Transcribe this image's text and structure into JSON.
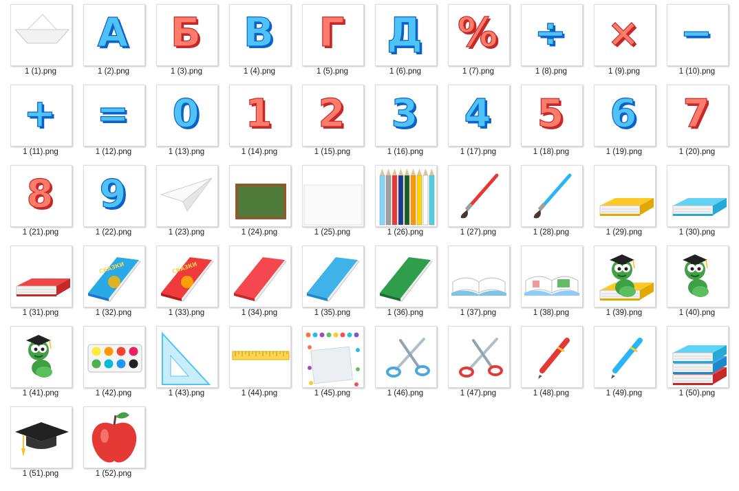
{
  "files": [
    {
      "name": "1 (1).png",
      "icon": "paper-boat-icon"
    },
    {
      "name": "1 (2).png",
      "icon": "letter-a-icon",
      "glyph": "А",
      "colors": [
        "#4fc3f7",
        "#0b63c9"
      ]
    },
    {
      "name": "1 (3).png",
      "icon": "letter-be-icon",
      "glyph": "Б",
      "colors": [
        "#ff7b6b",
        "#c62828"
      ]
    },
    {
      "name": "1 (4).png",
      "icon": "letter-ve-icon",
      "glyph": "В",
      "colors": [
        "#4fc3f7",
        "#0b63c9"
      ]
    },
    {
      "name": "1 (5).png",
      "icon": "letter-ge-icon",
      "glyph": "Г",
      "colors": [
        "#ff7b6b",
        "#c62828"
      ]
    },
    {
      "name": "1 (6).png",
      "icon": "letter-de-icon",
      "glyph": "Д",
      "colors": [
        "#4fc3f7",
        "#0b63c9"
      ]
    },
    {
      "name": "1 (7).png",
      "icon": "percent-sign-icon",
      "glyph": "%",
      "colors": [
        "#ff7b6b",
        "#c62828"
      ]
    },
    {
      "name": "1 (8).png",
      "icon": "division-sign-icon",
      "glyph": "÷",
      "colors": [
        "#4fc3f7",
        "#0b63c9"
      ]
    },
    {
      "name": "1 (9).png",
      "icon": "multiplication-sign-icon",
      "glyph": "×",
      "colors": [
        "#ff7b6b",
        "#c62828"
      ]
    },
    {
      "name": "1 (10).png",
      "icon": "minus-sign-icon",
      "glyph": "−",
      "colors": [
        "#4fc3f7",
        "#0b63c9"
      ]
    },
    {
      "name": "1 (11).png",
      "icon": "plus-sign-icon",
      "glyph": "+",
      "colors": [
        "#4fc3f7",
        "#0b63c9"
      ]
    },
    {
      "name": "1 (12).png",
      "icon": "equals-sign-icon",
      "glyph": "=",
      "colors": [
        "#4fc3f7",
        "#0b63c9"
      ]
    },
    {
      "name": "1 (13).png",
      "icon": "digit-0-icon",
      "glyph": "0",
      "colors": [
        "#4fc3f7",
        "#0b63c9"
      ]
    },
    {
      "name": "1 (14).png",
      "icon": "digit-1-icon",
      "glyph": "1",
      "colors": [
        "#ff7b6b",
        "#c62828"
      ]
    },
    {
      "name": "1 (15).png",
      "icon": "digit-2-icon",
      "glyph": "2",
      "colors": [
        "#ff7b6b",
        "#c62828"
      ]
    },
    {
      "name": "1 (16).png",
      "icon": "digit-3-icon",
      "glyph": "3",
      "colors": [
        "#4fc3f7",
        "#0b63c9"
      ]
    },
    {
      "name": "1 (17).png",
      "icon": "digit-4-icon",
      "glyph": "4",
      "colors": [
        "#4fc3f7",
        "#0b63c9"
      ]
    },
    {
      "name": "1 (18).png",
      "icon": "digit-5-icon",
      "glyph": "5",
      "colors": [
        "#ff7b6b",
        "#c62828"
      ]
    },
    {
      "name": "1 (19).png",
      "icon": "digit-6-icon",
      "glyph": "6",
      "colors": [
        "#4fc3f7",
        "#0b63c9"
      ]
    },
    {
      "name": "1 (20).png",
      "icon": "digit-7-icon",
      "glyph": "7",
      "colors": [
        "#ff7b6b",
        "#c62828"
      ]
    },
    {
      "name": "1 (21).png",
      "icon": "digit-8-icon",
      "glyph": "8",
      "colors": [
        "#ff7b6b",
        "#c62828"
      ]
    },
    {
      "name": "1 (22).png",
      "icon": "digit-9-icon",
      "glyph": "9",
      "colors": [
        "#4fc3f7",
        "#0b63c9"
      ]
    },
    {
      "name": "1 (23).png",
      "icon": "paper-plane-icon"
    },
    {
      "name": "1 (24).png",
      "icon": "chalkboard-icon"
    },
    {
      "name": "1 (25).png",
      "icon": "blank-sheet-icon"
    },
    {
      "name": "1 (26).png",
      "icon": "colored-pencils-icon"
    },
    {
      "name": "1 (27).png",
      "icon": "paintbrush-red-icon",
      "colors": [
        "#e53935"
      ]
    },
    {
      "name": "1 (28).png",
      "icon": "paintbrush-blue-icon",
      "colors": [
        "#29b6f6"
      ]
    },
    {
      "name": "1 (29).png",
      "icon": "book-yellow-icon",
      "colors": [
        "#ffc928",
        "#e0a800"
      ]
    },
    {
      "name": "1 (30).png",
      "icon": "book-cyan-icon",
      "colors": [
        "#5fd3f3",
        "#27a9d6"
      ]
    },
    {
      "name": "1 (31).png",
      "icon": "book-red-icon",
      "colors": [
        "#f04545",
        "#c62828"
      ]
    },
    {
      "name": "1 (32).png",
      "icon": "fairy-tales-book-blue-icon",
      "colors": [
        "#29a9e6",
        "#1976d2"
      ]
    },
    {
      "name": "1 (33).png",
      "icon": "fairy-tales-book-red-icon",
      "colors": [
        "#ef3b3b",
        "#b71c1c"
      ]
    },
    {
      "name": "1 (34).png",
      "icon": "book-standing-red-icon",
      "colors": [
        "#f5474f",
        "#c62828"
      ]
    },
    {
      "name": "1 (35).png",
      "icon": "book-standing-blue-icon",
      "colors": [
        "#3fb2ea",
        "#1e88c9"
      ]
    },
    {
      "name": "1 (36).png",
      "icon": "book-standing-green-icon",
      "colors": [
        "#2e9e4a",
        "#1b6e31"
      ]
    },
    {
      "name": "1 (37).png",
      "icon": "open-book-icon"
    },
    {
      "name": "1 (38).png",
      "icon": "open-book-illustrated-icon"
    },
    {
      "name": "1 (39).png",
      "icon": "bookworm-on-books-icon"
    },
    {
      "name": "1 (40).png",
      "icon": "bookworm-graduate-icon"
    },
    {
      "name": "1 (41).png",
      "icon": "bookworm-standing-icon"
    },
    {
      "name": "1 (42).png",
      "icon": "watercolor-paint-set-icon"
    },
    {
      "name": "1 (43).png",
      "icon": "set-square-icon"
    },
    {
      "name": "1 (44).png",
      "icon": "ruler-icon"
    },
    {
      "name": "1 (45).png",
      "icon": "push-pins-note-icon"
    },
    {
      "name": "1 (46).png",
      "icon": "scissors-blue-icon",
      "colors": [
        "#4aa9e0"
      ]
    },
    {
      "name": "1 (47).png",
      "icon": "scissors-red-icon",
      "colors": [
        "#e53935"
      ]
    },
    {
      "name": "1 (48).png",
      "icon": "pen-red-icon",
      "colors": [
        "#e53935"
      ]
    },
    {
      "name": "1 (49).png",
      "icon": "pen-blue-icon",
      "colors": [
        "#29b6f6"
      ]
    },
    {
      "name": "1 (50).png",
      "icon": "stack-of-books-icon"
    },
    {
      "name": "1 (51).png",
      "icon": "graduation-cap-icon"
    },
    {
      "name": "1 (52).png",
      "icon": "red-apple-icon"
    }
  ]
}
